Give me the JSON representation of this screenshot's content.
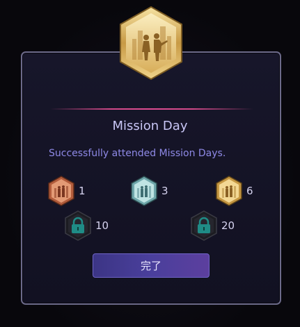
{
  "dialog": {
    "title": "Mission Day",
    "description": "Successfully attended Mission Days.",
    "header_badge_icon": "mission-day-gold-badge",
    "done_label": "完了"
  },
  "tiers": [
    {
      "count": "1",
      "medal": "bronze-medal-icon",
      "color": "#d9825a",
      "unlocked": true
    },
    {
      "count": "3",
      "medal": "silver-medal-icon",
      "color": "#9fd0d2",
      "unlocked": true
    },
    {
      "count": "6",
      "medal": "gold-medal-icon",
      "color": "#e2be6e",
      "unlocked": true
    },
    {
      "count": "10",
      "medal": "locked-medal-icon",
      "color": "#1f8c86",
      "unlocked": false
    },
    {
      "count": "20",
      "medal": "locked-medal-icon",
      "color": "#1f8c86",
      "unlocked": false
    }
  ],
  "colors": {
    "accent_line": "#e04d93",
    "title": "#c9c6f6",
    "description": "#8e89e6",
    "button": "#4a3f9c"
  }
}
